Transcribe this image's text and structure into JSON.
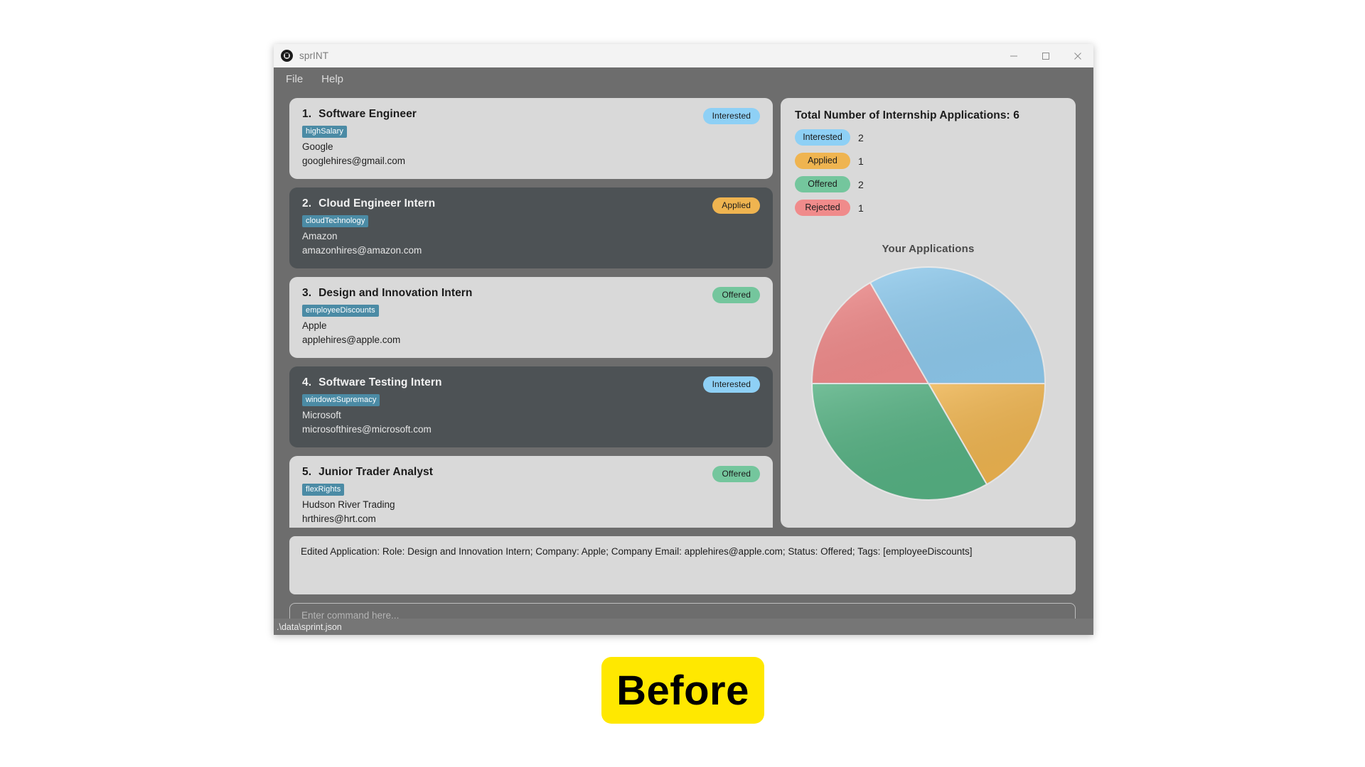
{
  "window": {
    "title": "sprINT",
    "icon": "app-logo-icon",
    "controls": {
      "minimize": "minimize-icon",
      "maximize": "maximize-icon",
      "close": "close-icon"
    }
  },
  "menu": {
    "items": [
      {
        "label": "File"
      },
      {
        "label": "Help"
      }
    ]
  },
  "applications": [
    {
      "index": "1.",
      "role": "Software Engineer",
      "tag": "highSalary",
      "company": "Google",
      "email": "googlehires@gmail.com",
      "status": "Interested",
      "status_color": "#8ed0f5",
      "theme": "light"
    },
    {
      "index": "2.",
      "role": "Cloud Engineer Intern",
      "tag": "cloudTechnology",
      "company": "Amazon",
      "email": "amazonhires@amazon.com",
      "status": "Applied",
      "status_color": "#efb450",
      "theme": "dark"
    },
    {
      "index": "3.",
      "role": "Design and Innovation Intern",
      "tag": "employeeDiscounts",
      "company": "Apple",
      "email": "applehires@apple.com",
      "status": "Offered",
      "status_color": "#74c69d",
      "theme": "light"
    },
    {
      "index": "4.",
      "role": "Software Testing Intern",
      "tag": "windowsSupremacy",
      "company": "Microsoft",
      "email": "microsofthires@microsoft.com",
      "status": "Interested",
      "status_color": "#8ed0f5",
      "theme": "dark"
    },
    {
      "index": "5.",
      "role": "Junior Trader Analyst",
      "tag": "flexRights",
      "company": "Hudson River Trading",
      "email": "hrthires@hrt.com",
      "status": "Offered",
      "status_color": "#74c69d",
      "theme": "light"
    }
  ],
  "stats": {
    "title": "Total Number of Internship Applications: 6",
    "rows": [
      {
        "label": "Interested",
        "count": "2",
        "color": "#8ed0f5"
      },
      {
        "label": "Applied",
        "count": "1",
        "color": "#efb450"
      },
      {
        "label": "Offered",
        "count": "2",
        "color": "#74c69d"
      },
      {
        "label": "Rejected",
        "count": "1",
        "color": "#f08b8b"
      }
    ]
  },
  "chart_data": {
    "type": "pie",
    "title": "Your Applications",
    "categories": [
      "Interested",
      "Applied",
      "Offered",
      "Rejected"
    ],
    "values": [
      2,
      1,
      2,
      1
    ],
    "total": 6,
    "colors": [
      "#8ec9ec",
      "#eeb450",
      "#56b183",
      "#ef8b8b"
    ],
    "start_angle_deg": 0,
    "direction": "clockwise",
    "legend": "left-panel-pills",
    "labels_shown": false
  },
  "result": {
    "text": "Edited Application: Role: Design and Innovation Intern; Company: Apple; Company Email: applehires@apple.com; Status: Offered; Tags: [employeeDiscounts]"
  },
  "command": {
    "placeholder": "Enter command here...",
    "value": ""
  },
  "statusbar": {
    "path": ".\\data\\sprint.json"
  },
  "annotation": {
    "label": "Before",
    "background": "#ffe800"
  }
}
